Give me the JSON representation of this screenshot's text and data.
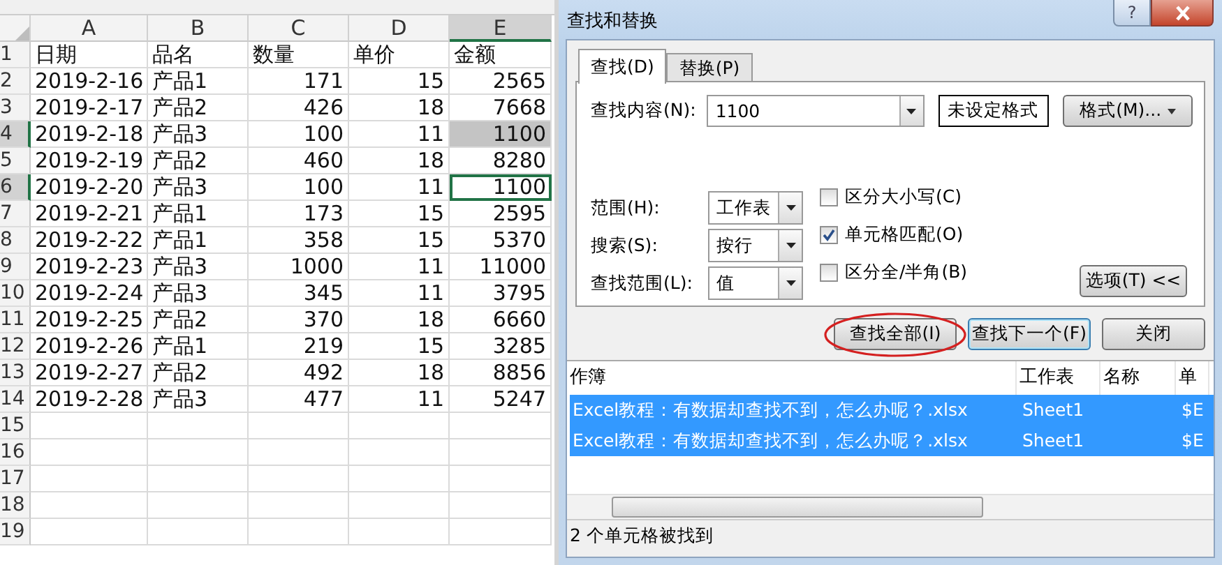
{
  "sheet": {
    "columns": [
      {
        "label": "A",
        "selected": false
      },
      {
        "label": "B",
        "selected": false
      },
      {
        "label": "C",
        "selected": false
      },
      {
        "label": "D",
        "selected": false
      },
      {
        "label": "E",
        "selected": true
      }
    ],
    "rows": [
      {
        "number": "1",
        "selected": false,
        "cells": [
          "日期",
          "品名",
          "数量",
          "单价",
          "金额"
        ],
        "shaded": false,
        "active": false
      },
      {
        "number": "2",
        "selected": false,
        "cells": [
          "2019-2-16",
          "产品1",
          "171",
          "15",
          "2565"
        ],
        "shaded": false,
        "active": false
      },
      {
        "number": "3",
        "selected": false,
        "cells": [
          "2019-2-17",
          "产品2",
          "426",
          "18",
          "7668"
        ],
        "shaded": false,
        "active": false
      },
      {
        "number": "4",
        "selected": true,
        "cells": [
          "2019-2-18",
          "产品3",
          "100",
          "11",
          "1100"
        ],
        "shaded": true,
        "active": false
      },
      {
        "number": "5",
        "selected": false,
        "cells": [
          "2019-2-19",
          "产品2",
          "460",
          "18",
          "8280"
        ],
        "shaded": false,
        "active": false
      },
      {
        "number": "6",
        "selected": true,
        "cells": [
          "2019-2-20",
          "产品3",
          "100",
          "11",
          "1100"
        ],
        "shaded": false,
        "active": true
      },
      {
        "number": "7",
        "selected": false,
        "cells": [
          "2019-2-21",
          "产品1",
          "173",
          "15",
          "2595"
        ],
        "shaded": false,
        "active": false
      },
      {
        "number": "8",
        "selected": false,
        "cells": [
          "2019-2-22",
          "产品1",
          "358",
          "15",
          "5370"
        ],
        "shaded": false,
        "active": false
      },
      {
        "number": "9",
        "selected": false,
        "cells": [
          "2019-2-23",
          "产品3",
          "1000",
          "11",
          "11000"
        ],
        "shaded": false,
        "active": false
      },
      {
        "number": "10",
        "selected": false,
        "cells": [
          "2019-2-24",
          "产品3",
          "345",
          "11",
          "3795"
        ],
        "shaded": false,
        "active": false
      },
      {
        "number": "11",
        "selected": false,
        "cells": [
          "2019-2-25",
          "产品2",
          "370",
          "18",
          "6660"
        ],
        "shaded": false,
        "active": false
      },
      {
        "number": "12",
        "selected": false,
        "cells": [
          "2019-2-26",
          "产品1",
          "219",
          "15",
          "3285"
        ],
        "shaded": false,
        "active": false
      },
      {
        "number": "13",
        "selected": false,
        "cells": [
          "2019-2-27",
          "产品2",
          "492",
          "18",
          "8856"
        ],
        "shaded": false,
        "active": false
      },
      {
        "number": "14",
        "selected": false,
        "cells": [
          "2019-2-28",
          "产品3",
          "477",
          "11",
          "5247"
        ],
        "shaded": false,
        "active": false
      },
      {
        "number": "15",
        "selected": false,
        "cells": [],
        "shaded": false,
        "active": false
      },
      {
        "number": "16",
        "selected": false,
        "cells": [],
        "shaded": false,
        "active": false
      },
      {
        "number": "17",
        "selected": false,
        "cells": [],
        "shaded": false,
        "active": false
      },
      {
        "number": "18",
        "selected": false,
        "cells": [],
        "shaded": false,
        "active": false
      },
      {
        "number": "19",
        "selected": false,
        "cells": [],
        "shaded": false,
        "active": false
      }
    ]
  },
  "dialog": {
    "title": "查找和替换",
    "help": "?",
    "tabs": [
      {
        "label": "查找(D)",
        "selected": true
      },
      {
        "label": "替换(P)",
        "selected": false
      }
    ],
    "find": {
      "label": "查找内容(N):",
      "value": "1100",
      "format_preview": "未设定格式",
      "format_button": "格式(M)..."
    },
    "dropdowns": [
      {
        "label": "范围(H):",
        "value": "工作表"
      },
      {
        "label": "搜索(S):",
        "value": "按行"
      },
      {
        "label": "查找范围(L):",
        "value": "值"
      }
    ],
    "checkboxes": [
      {
        "label": "区分大小写(C)",
        "checked": false
      },
      {
        "label": "单元格匹配(O)",
        "checked": true
      },
      {
        "label": "区分全/半角(B)",
        "checked": false
      }
    ],
    "options_button": "选项(T) <<",
    "buttons": [
      {
        "label": "查找全部(I)",
        "circled": true,
        "default": false
      },
      {
        "label": "查找下一个(F)",
        "circled": false,
        "default": true
      },
      {
        "label": "关闭",
        "circled": false,
        "default": false
      }
    ],
    "results": {
      "columns": [
        "作簿",
        "工作表",
        "名称",
        "单"
      ],
      "rows": [
        {
          "workbook": "Excel教程：有数据却查找不到，怎么办呢？.xlsx",
          "sheet": "Sheet1",
          "cell": "$E",
          "selected": true
        },
        {
          "workbook": "Excel教程：有数据却查找不到，怎么办呢？.xlsx",
          "sheet": "Sheet1",
          "cell": "$E",
          "selected": true
        }
      ]
    },
    "status": "2 个单元格被找到"
  }
}
